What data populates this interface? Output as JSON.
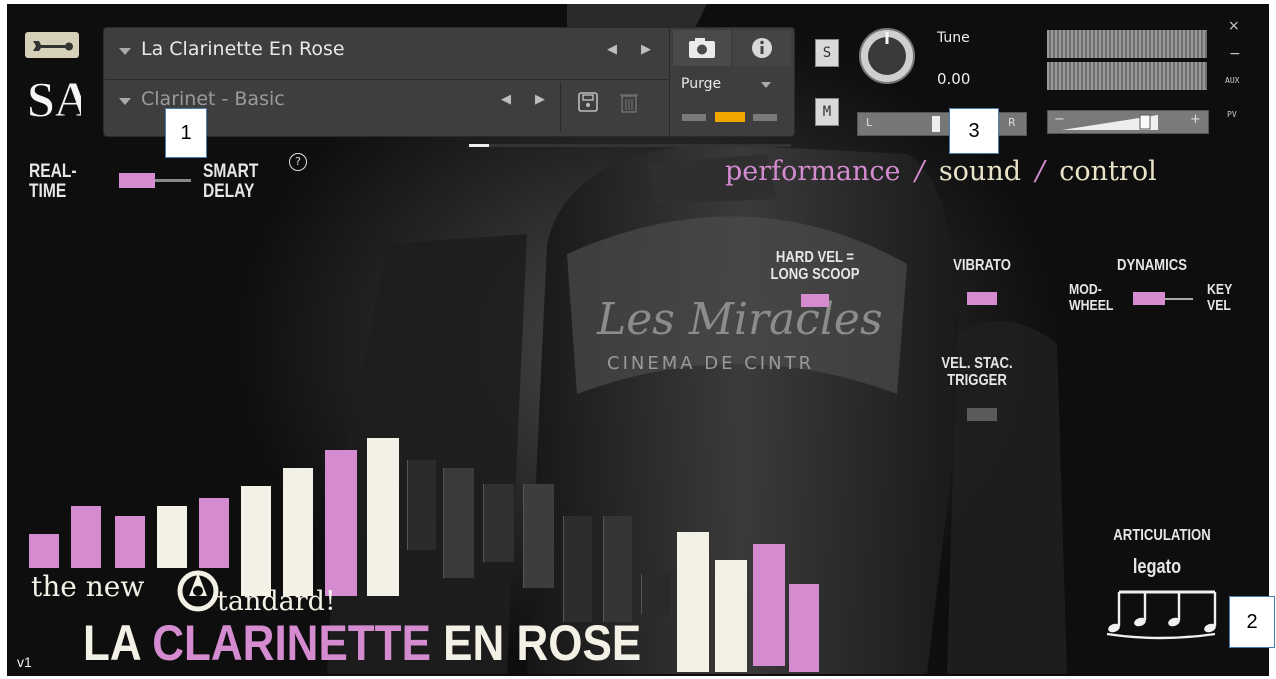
{
  "header": {
    "instrument_name": "La Clarinette En Rose",
    "preset_name": "Clarinet - Basic",
    "purge_label": "Purge",
    "solo_label": "S",
    "mute_label": "M",
    "tune_label": "Tune",
    "tune_value": "0.00",
    "pan_left": "L",
    "pan_right": "R",
    "aux_label": "AUX",
    "pv_label": "PV",
    "vol_minus": "−",
    "vol_plus": "+",
    "close_glyph": "×",
    "minimize_glyph": "−"
  },
  "logo_text": "SA",
  "mode": {
    "left_label_1": "REAL-",
    "left_label_2": "TIME",
    "right_label_1": "SMART",
    "right_label_2": "DELAY",
    "help_glyph": "?"
  },
  "tabs": {
    "performance": "performance",
    "sep1": "/",
    "sound": "sound",
    "sep2": "/",
    "control": "control"
  },
  "controls": {
    "hard_vel_1": "HARD VEL =",
    "hard_vel_2": "LONG SCOOP",
    "vibrato": "VIBRATO",
    "dynamics": "DYNAMICS",
    "mod_1": "MOD-",
    "mod_2": "WHEEL",
    "key_1": "KEY",
    "key_2": "VEL",
    "vel_stac_1": "VEL. STAC.",
    "vel_stac_2": "TRIGGER",
    "articulation_label": "ARTICULATION",
    "articulation_value": "legato"
  },
  "branding": {
    "the_new": "the new",
    "standard": "tandard!",
    "title_la": "LA",
    "title_clarinette": "CLARINETTE",
    "title_en_rose": "EN ROSE",
    "version": "v1"
  },
  "callouts": [
    "1",
    "2",
    "3"
  ],
  "colors": {
    "pink": "#d48bd0",
    "cream": "#f3f0e6",
    "panel": "#3e3e3e"
  },
  "icons": [
    "wrench-icon",
    "camera-icon",
    "info-icon",
    "save-icon",
    "trash-icon",
    "tune-knob-icon",
    "legato-notes-icon",
    "help-icon",
    "record-45-adapter-icon"
  ]
}
